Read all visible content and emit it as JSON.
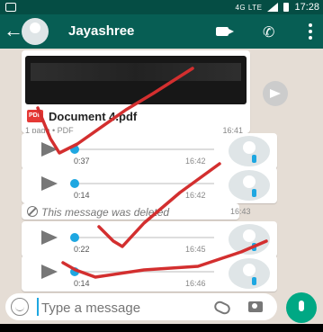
{
  "status_bar": {
    "network": "4G LTE",
    "time": "17:28"
  },
  "toolbar": {
    "contact_name": "Jayashree"
  },
  "document_message": {
    "file_name": "Document 4.pdf",
    "meta": "1 page • PDF",
    "time": "16:41",
    "type_badge": "PDF"
  },
  "voice_messages": [
    {
      "duration": "0:37",
      "time": "16:42"
    },
    {
      "duration": "0:14",
      "time": "16:42"
    },
    {
      "duration": "0:22",
      "time": "16:45"
    },
    {
      "duration": "0:14",
      "time": "16:46"
    }
  ],
  "deleted_message": {
    "text": "This message was deleted",
    "time": "16:43"
  },
  "composer": {
    "placeholder": "Type a message"
  },
  "colors": {
    "header": "#075e54",
    "accent": "#00a884",
    "voice_dot": "#1ea7e1",
    "annotation": "#d32f2f"
  }
}
